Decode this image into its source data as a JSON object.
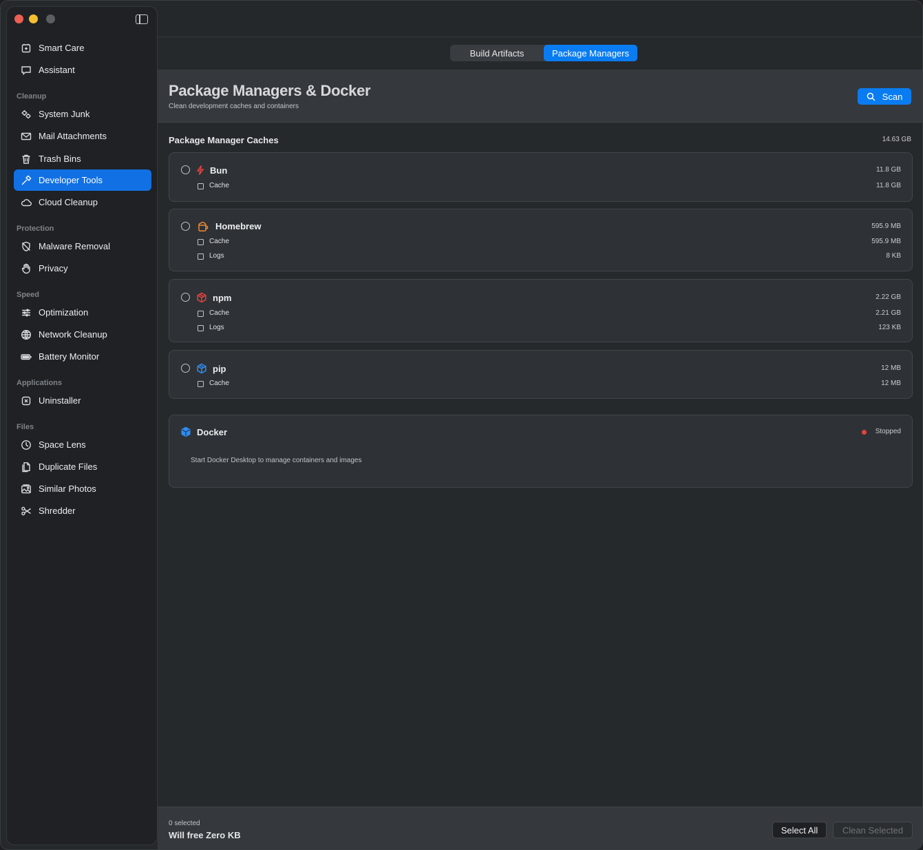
{
  "sidebar": {
    "items": [
      {
        "label": "Smart Care",
        "icon": "smart-care-icon"
      },
      {
        "label": "Assistant",
        "icon": "chat-bubble-icon"
      },
      {
        "label": "System Junk",
        "icon": "gears-icon"
      },
      {
        "label": "Mail Attachments",
        "icon": "envelope-icon"
      },
      {
        "label": "Trash Bins",
        "icon": "trash-icon"
      },
      {
        "label": "Developer Tools",
        "icon": "hammer-icon"
      },
      {
        "label": "Cloud Cleanup",
        "icon": "cloud-icon"
      },
      {
        "label": "Malware Removal",
        "icon": "shield-slash-icon"
      },
      {
        "label": "Privacy",
        "icon": "hand-icon"
      },
      {
        "label": "Optimization",
        "icon": "sliders-icon"
      },
      {
        "label": "Network Cleanup",
        "icon": "globe-icon"
      },
      {
        "label": "Battery Monitor",
        "icon": "battery-icon"
      },
      {
        "label": "Uninstaller",
        "icon": "xmark-square-icon"
      },
      {
        "label": "Space Lens",
        "icon": "pie-clock-icon"
      },
      {
        "label": "Duplicate Files",
        "icon": "documents-icon"
      },
      {
        "label": "Similar Photos",
        "icon": "photos-icon"
      },
      {
        "label": "Shredder",
        "icon": "scissors-icon"
      }
    ],
    "sections": [
      "Cleanup",
      "Protection",
      "Speed",
      "Applications",
      "Files"
    ],
    "active": "Developer Tools"
  },
  "tabs": [
    {
      "label": "Build Artifacts",
      "selected": false
    },
    {
      "label": "Package Managers",
      "selected": true
    }
  ],
  "header": {
    "title": "Package Managers & Docker",
    "subtitle": "Clean development caches and containers",
    "scan_label": "Scan"
  },
  "caches": {
    "title": "Package Manager Caches",
    "total": "14.63 GB",
    "managers": [
      {
        "name": "Bun",
        "size": "11.8 GB",
        "icon": "bolt-icon",
        "items": [
          {
            "label": "Cache",
            "size": "11.8 GB"
          }
        ]
      },
      {
        "name": "Homebrew",
        "size": "595.9 MB",
        "icon": "beer-mug-icon",
        "items": [
          {
            "label": "Cache",
            "size": "595.9 MB"
          },
          {
            "label": "Logs",
            "size": "8 KB"
          }
        ]
      },
      {
        "name": "npm",
        "size": "2.22 GB",
        "icon": "npm-box-icon",
        "items": [
          {
            "label": "Cache",
            "size": "2.21 GB"
          },
          {
            "label": "Logs",
            "size": "123 KB"
          }
        ]
      },
      {
        "name": "pip",
        "size": "12 MB",
        "icon": "pip-box-icon",
        "items": [
          {
            "label": "Cache",
            "size": "12 MB"
          }
        ]
      }
    ]
  },
  "docker": {
    "name": "Docker",
    "status": "Stopped",
    "message": "Start Docker Desktop to manage containers and images"
  },
  "footer": {
    "selected_text": "0 selected",
    "free_text": "Will free Zero KB",
    "select_all_label": "Select All",
    "clean_label": "Clean Selected"
  },
  "colors": {
    "accent": "#0a7cf1",
    "active_nav": "#1170e4",
    "bun": "#e5423c",
    "homebrew": "#f08a30",
    "npm": "#e5423c",
    "pip": "#2f8cf0",
    "docker": "#2f8cf0",
    "stopped": "#e5423c"
  }
}
